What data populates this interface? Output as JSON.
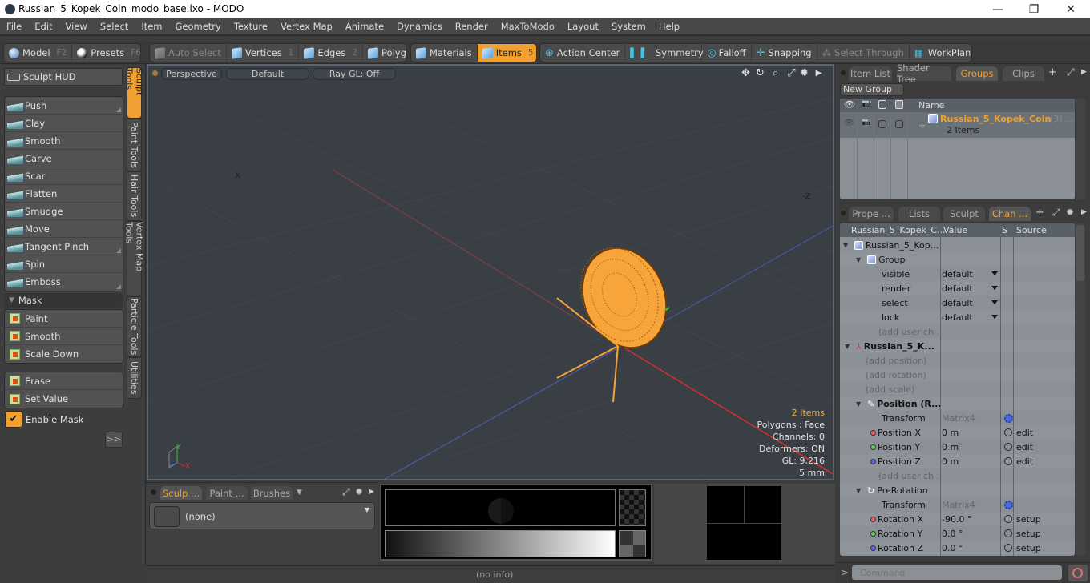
{
  "window": {
    "title": "Russian_5_Kopek_Coin_modo_base.lxo - MODO",
    "minimize_glyph": "—",
    "maximize_glyph": "❐",
    "close_glyph": "✕"
  },
  "menu": [
    "File",
    "Edit",
    "View",
    "Select",
    "Item",
    "Geometry",
    "Texture",
    "Vertex Map",
    "Animate",
    "Dynamics",
    "Render",
    "MaxToModo",
    "Layout",
    "System",
    "Help"
  ],
  "toolbar": {
    "model": {
      "label": "Model",
      "key": "F2"
    },
    "presets": {
      "label": "Presets",
      "key": "F6"
    },
    "auto_select": {
      "label": "Auto Select"
    },
    "vertices": {
      "label": "Vertices",
      "key": "1"
    },
    "edges": {
      "label": "Edges",
      "key": "2"
    },
    "polygons": {
      "label": "Polygons"
    },
    "materials": {
      "label": "Materials"
    },
    "items": {
      "label": "Items",
      "key": "5"
    },
    "action_center": {
      "label": "Action Center"
    },
    "symmetry": {
      "label": "Symmetry"
    },
    "falloff": {
      "label": "Falloff"
    },
    "snapping": {
      "label": "Snapping"
    },
    "select_through": {
      "label": "Select Through"
    },
    "workplane": {
      "label": "WorkPlane"
    },
    "active_color": "#f0a030"
  },
  "left_panel": {
    "sculpt_hud": "Sculpt HUD",
    "sculpt_tools": [
      "Push",
      "Clay",
      "Smooth",
      "Carve",
      "Scar",
      "Flatten",
      "Smudge",
      "Move",
      "Tangent Pinch",
      "Spin",
      "Emboss"
    ],
    "mask_header": "Mask",
    "mask_tools": [
      "Paint",
      "Smooth",
      "Scale Down"
    ],
    "mask_tools2": [
      "Erase",
      "Set Value"
    ],
    "enable_mask": "Enable Mask",
    "enable_mask_checked": true,
    "expand_label": ">>",
    "vertical_tabs": [
      "Sculpt Tools",
      "Paint Tools",
      "Hair Tools",
      "Vertex Map Tools",
      "Particle Tools",
      "Utilities"
    ],
    "active_tab": "Sculpt Tools"
  },
  "viewport": {
    "view_mode": "Perspective",
    "shading": "Default",
    "raygl": "Ray GL: Off",
    "axis_labels": {
      "x": "X",
      "neg_z": "-Z"
    },
    "hud": {
      "items": "2 Items",
      "polygons": "Polygons : Face",
      "channels": "Channels: 0",
      "deformers": "Deformers: ON",
      "gl": "GL: 9,216",
      "scale": "5 mm"
    },
    "gizmo": {
      "x": "X",
      "y": "Y"
    },
    "mesh_color": "#f7a53a"
  },
  "bottom_left": {
    "tabs": [
      "Sculp ...",
      "Paint ...",
      "Brushes"
    ],
    "active_tab": "Sculp ...",
    "brush_value": "(none)"
  },
  "status": {
    "info": "(no info)"
  },
  "groups_panel": {
    "tabs": [
      "Item List",
      "Shader Tree",
      "Groups",
      "Clips"
    ],
    "active_tab": "Groups",
    "new_group": "New Group",
    "columns": {
      "name": "Name"
    },
    "group": {
      "name": "Russian_5_Kopek_Coin",
      "count": "(3) ...",
      "sub": "2 Items"
    }
  },
  "channels_panel": {
    "tabs": [
      "Prope ...",
      "Lists",
      "Sculpt",
      "Chan ..."
    ],
    "active_tab": "Chan ...",
    "columns": [
      "Russian_5_Kopek_C...",
      "Value",
      "S",
      "Source"
    ],
    "rows": [
      {
        "name": "Russian_5_Kop...",
        "value": "",
        "source": "",
        "type": "root"
      },
      {
        "name": "Group",
        "value": "",
        "source": "",
        "type": "group"
      },
      {
        "name": "visible",
        "value": "default",
        "source": "",
        "type": "dd"
      },
      {
        "name": "render",
        "value": "default",
        "source": "",
        "type": "dd"
      },
      {
        "name": "select",
        "value": "default",
        "source": "",
        "type": "dd"
      },
      {
        "name": "lock",
        "value": "default",
        "source": "",
        "type": "dd"
      },
      {
        "name": "(add user ch ...",
        "value": "",
        "source": "",
        "type": "add"
      },
      {
        "name": "Russian_5_K...",
        "value": "",
        "source": "",
        "type": "locator"
      },
      {
        "name": "(add position)",
        "value": "",
        "source": "",
        "type": "add"
      },
      {
        "name": "(add rotation)",
        "value": "",
        "source": "",
        "type": "add"
      },
      {
        "name": "(add scale)",
        "value": "",
        "source": "",
        "type": "add"
      },
      {
        "name": "Position (R...",
        "value": "",
        "source": "",
        "type": "section"
      },
      {
        "name": "Transform",
        "value": "Matrix4",
        "source": "",
        "type": "matrix"
      },
      {
        "name": "Position X",
        "value": "0 m",
        "source": "edit",
        "type": "x"
      },
      {
        "name": "Position Y",
        "value": "0 m",
        "source": "edit",
        "type": "y"
      },
      {
        "name": "Position Z",
        "value": "0 m",
        "source": "edit",
        "type": "z"
      },
      {
        "name": "(add user ch ...",
        "value": "",
        "source": "",
        "type": "add"
      },
      {
        "name": "PreRotation",
        "value": "",
        "source": "",
        "type": "section2"
      },
      {
        "name": "Transform",
        "value": "Matrix4",
        "source": "",
        "type": "matrix"
      },
      {
        "name": "Rotation X",
        "value": "-90.0 °",
        "source": "setup",
        "type": "x"
      },
      {
        "name": "Rotation Y",
        "value": "0.0 °",
        "source": "setup",
        "type": "y"
      },
      {
        "name": "Rotation Z",
        "value": "0.0 °",
        "source": "setup",
        "type": "z"
      }
    ]
  },
  "command": {
    "placeholder": "Command"
  }
}
